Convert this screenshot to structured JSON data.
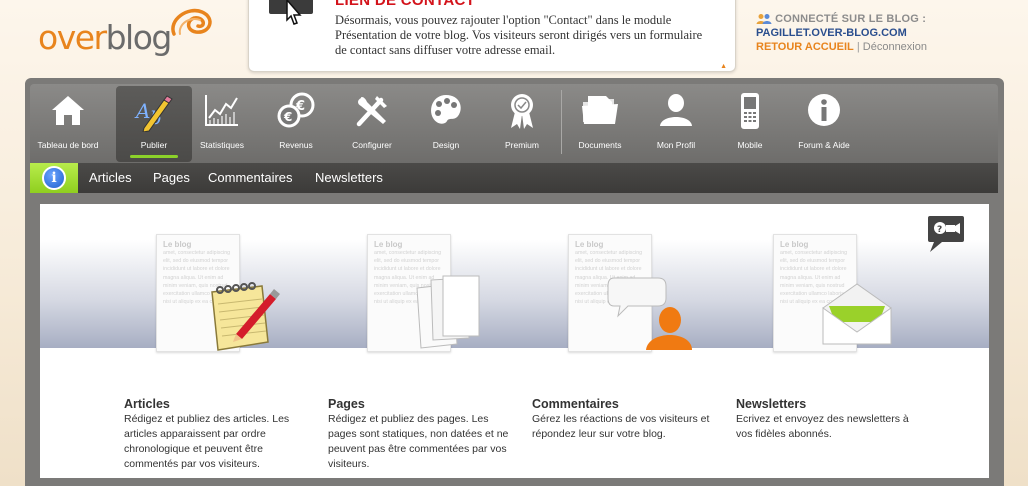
{
  "logo": {
    "part1": "over",
    "part2": "blog"
  },
  "notice": {
    "title": "LIEN DE CONTACT",
    "body": "Désormais, vous pouvez rajouter l'option \"Contact\" dans le module Présentation de votre blog. Vos visiteurs seront dirigés vers un formulaire de contact sans diffuser votre adresse email.",
    "scroll_glyph": "▲"
  },
  "user": {
    "connected_label": "CONNECTÉ SUR LE BLOG :",
    "blog_name": "PAGILLET.OVER-BLOG.COM",
    "home_link": "RETOUR ACCUEIL",
    "separator": "|",
    "logout_link": "Déconnexion"
  },
  "toolbar": {
    "items": [
      {
        "label": "Tableau de bord",
        "icon": "home-icon"
      },
      {
        "label": "Publier",
        "icon": "pencil-ab-icon"
      },
      {
        "label": "Statistiques",
        "icon": "chart-icon"
      },
      {
        "label": "Revenus",
        "icon": "coins-icon"
      },
      {
        "label": "Configurer",
        "icon": "tools-icon"
      },
      {
        "label": "Design",
        "icon": "palette-icon"
      },
      {
        "label": "Premium",
        "icon": "ribbon-icon"
      },
      {
        "label": "Documents",
        "icon": "folder-icon"
      },
      {
        "label": "Mon Profil",
        "icon": "profile-icon"
      },
      {
        "label": "Mobile",
        "icon": "mobile-icon"
      },
      {
        "label": "Forum & Aide",
        "icon": "info-icon"
      }
    ],
    "active": "Publier"
  },
  "subnav": {
    "info_glyph": "i",
    "items": [
      "Articles",
      "Pages",
      "Commentaires",
      "Newsletters"
    ]
  },
  "paper": {
    "title": "Le blog",
    "text": "amet, consectetur adipiscing elit, sed do eiusmod tempor incididunt ut labore et dolore magna aliqua. Ut enim ad minim veniam, quis nostrud exercitation ullamco laboris nisi ut aliquip ex ea commodo"
  },
  "features": [
    {
      "title": "Articles",
      "desc": "Rédigez et publiez des articles. Les articles apparaissent par ordre chronologique et peuvent être commentés par vos visiteurs."
    },
    {
      "title": "Pages",
      "desc": "Rédigez et publiez des pages. Les pages sont statiques, non datées et ne peuvent pas être commentées par vos visiteurs."
    },
    {
      "title": "Commentaires",
      "desc": "Gérez les réactions de vos visiteurs et répondez leur sur votre blog."
    },
    {
      "title": "Newsletters",
      "desc": "Ecrivez et envoyez des newsletters à vos fidèles abonnés."
    }
  ],
  "colors": {
    "brand_orange": "#e8841d",
    "notice_red": "#d3131b",
    "active_green": "#8cd12a",
    "link_blue": "#2a4e8e"
  }
}
